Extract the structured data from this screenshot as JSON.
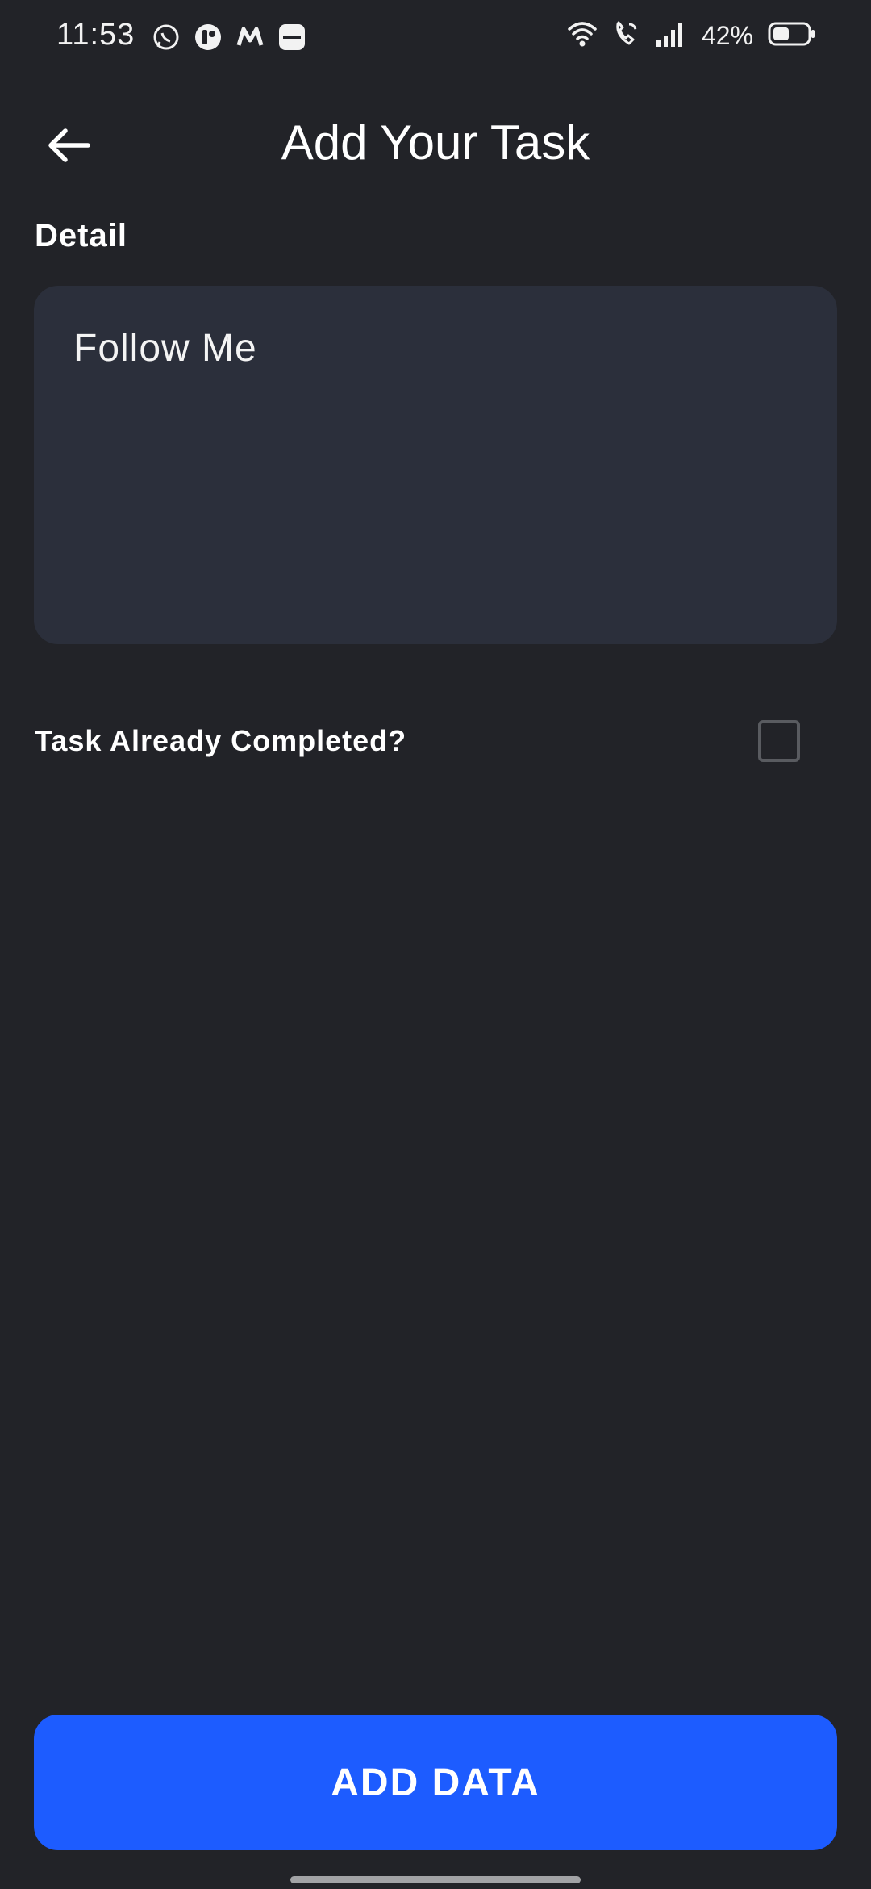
{
  "status_bar": {
    "time": "11:53",
    "notification_icons": [
      "whatsapp-icon",
      "messenger-style-icon",
      "myntra-icon",
      "paytm-icon"
    ],
    "battery": "42%"
  },
  "header": {
    "title": "Add Your Task"
  },
  "detail": {
    "label": "Detail",
    "value": "Follow Me"
  },
  "completed": {
    "label": "Task Already Completed?",
    "checked": false
  },
  "action": {
    "button_label": "ADD DATA"
  },
  "colors": {
    "background": "#222328",
    "input_background": "#2b2f3b",
    "accent": "#1d5cff"
  }
}
